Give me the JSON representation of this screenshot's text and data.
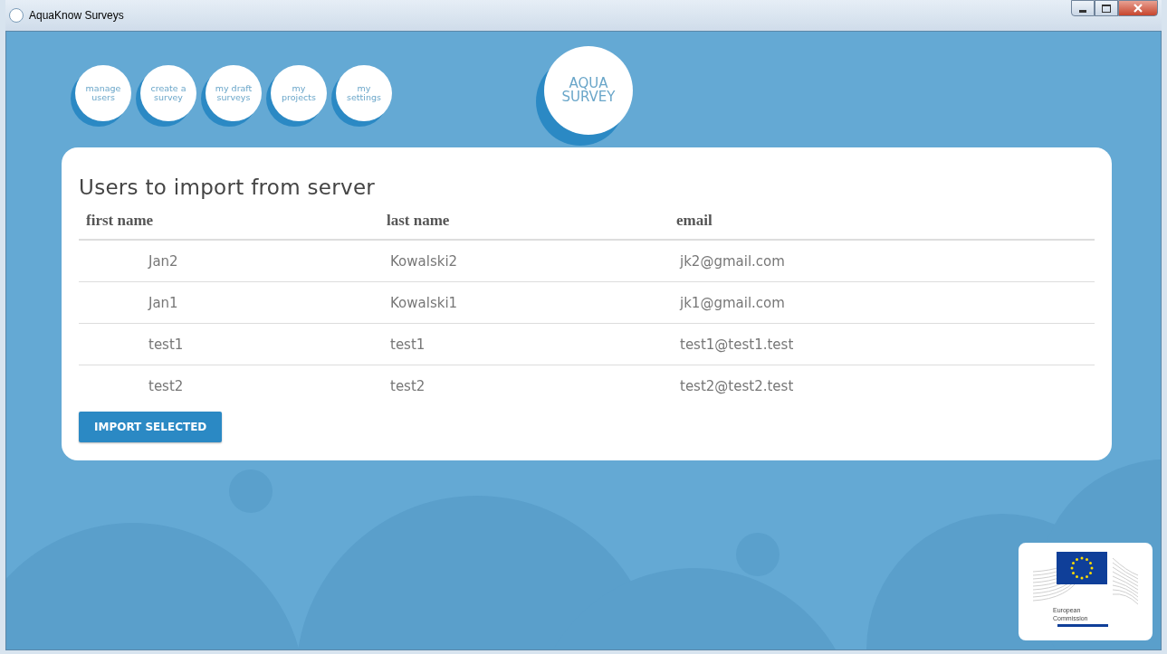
{
  "window": {
    "title": "AquaKnow Surveys"
  },
  "nav": [
    {
      "lines": [
        "manage",
        "users"
      ]
    },
    {
      "lines": [
        "create a",
        "survey"
      ]
    },
    {
      "lines": [
        "my draft",
        "surveys"
      ]
    },
    {
      "lines": [
        "my",
        "projects"
      ]
    },
    {
      "lines": [
        "my",
        "settings"
      ]
    }
  ],
  "logo": {
    "lines": [
      "AQUA",
      "SURVEY"
    ]
  },
  "panel": {
    "title": "Users to import from server",
    "columns": [
      "first name",
      "last name",
      "email"
    ],
    "rows": [
      [
        "Jan2",
        "Kowalski2",
        "jk2@gmail.com"
      ],
      [
        "Jan1",
        "Kowalski1",
        "jk1@gmail.com"
      ],
      [
        "test1",
        "test1",
        "test1@test1.test"
      ],
      [
        "test2",
        "test2",
        "test2@test2.test"
      ]
    ],
    "button": "IMPORT SELECTED"
  },
  "partner_logo": {
    "caption": [
      "European",
      "Commission"
    ]
  }
}
